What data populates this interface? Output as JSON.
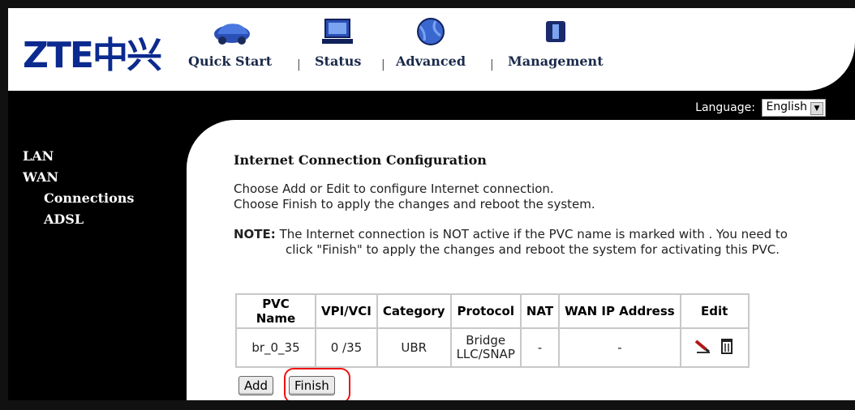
{
  "header": {
    "logo": "ZTE中兴",
    "nav": [
      {
        "label": "Quick Start",
        "icon": "car-icon"
      },
      {
        "label": "Status",
        "icon": "monitor-icon"
      },
      {
        "label": "Advanced",
        "icon": "globe-icon"
      },
      {
        "label": "Management",
        "icon": "folder-icon"
      }
    ],
    "separator": "|"
  },
  "language": {
    "label": "Language:",
    "value": "English"
  },
  "sidebar": {
    "items": [
      {
        "label": "LAN"
      },
      {
        "label": "WAN"
      },
      {
        "label": "Connections"
      },
      {
        "label": "ADSL"
      }
    ]
  },
  "main": {
    "title": "Internet Connection Configuration",
    "desc_line1": "Choose Add or Edit to configure Internet connection.",
    "desc_line2": "Choose Finish to apply the changes and reboot the system.",
    "note_label": "NOTE:",
    "note_line1": "The Internet connection is NOT active if the PVC name is marked with . You need to",
    "note_line2": "click \"Finish\" to apply the changes and reboot the system for activating this PVC.",
    "table": {
      "headers": [
        "PVC Name",
        "VPI/VCI",
        "Category",
        "Protocol",
        "NAT",
        "WAN IP Address",
        "Edit"
      ],
      "rows": [
        {
          "pvc": "br_0_35",
          "vpivci": "0 /35",
          "category": "UBR",
          "protocol_line1": "Bridge",
          "protocol_line2": "LLC/SNAP",
          "nat": "-",
          "wan_ip": "-"
        }
      ]
    },
    "add_label": "Add",
    "finish_label": "Finish"
  },
  "colors": {
    "logo": "#0b2a8f",
    "highlight_ring": "#e11111",
    "background": "#000000"
  }
}
